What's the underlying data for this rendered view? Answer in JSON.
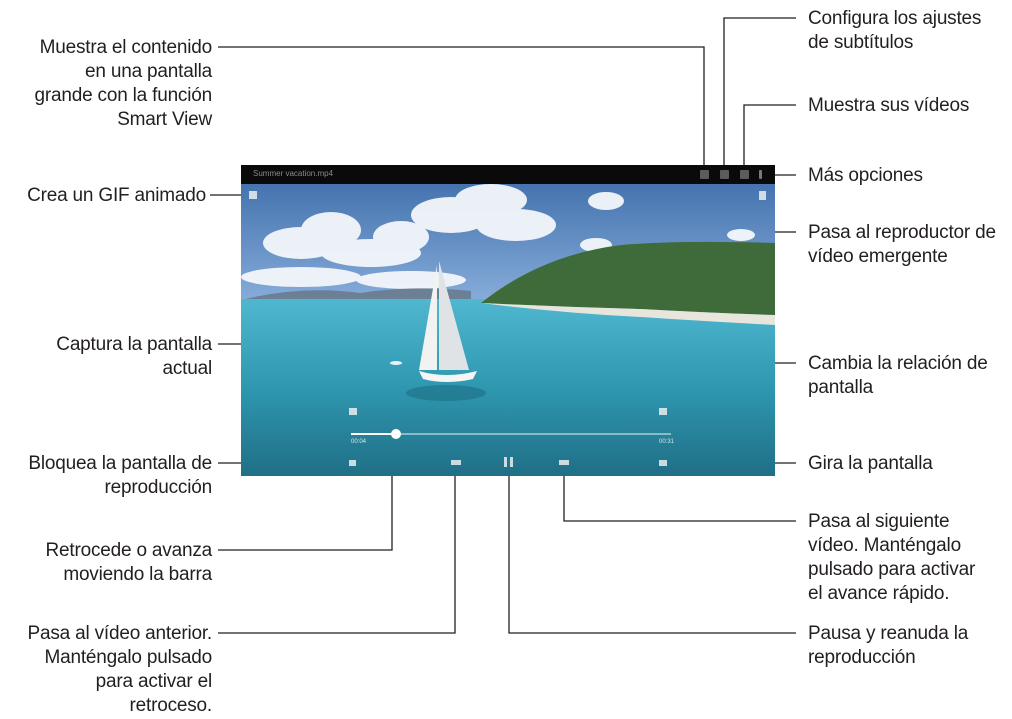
{
  "video": {
    "title": "Summer vacation.mp4",
    "progress": 0.14,
    "time_current": "00:04",
    "time_total": "00:31"
  },
  "callouts": {
    "smart_view": "Muestra el contenido\nen una pantalla\ngrande con la función\nSmart View",
    "gif": "Crea un GIF animado",
    "capture": "Captura la pantalla\nactual",
    "lock": "Bloquea la pantalla de\nreproducción",
    "seek": "Retrocede o avanza\nmoviendo la barra",
    "previous": "Pasa al vídeo anterior.\nManténgalo pulsado\npara activar el\nretroceso.",
    "subtitles": "Configura los ajustes\nde subtítulos",
    "videos": "Muestra sus vídeos",
    "more": "Más opciones",
    "popup": "Pasa al reproductor de\nvídeo emergente",
    "ratio": "Cambia la relación de\npantalla",
    "rotate": "Gira la pantalla",
    "next": "Pasa al siguiente\nvídeo. Manténgalo\npulsado para activar\nel avance rápido.",
    "pause": "Pausa y reanuda la\nreproducción"
  }
}
